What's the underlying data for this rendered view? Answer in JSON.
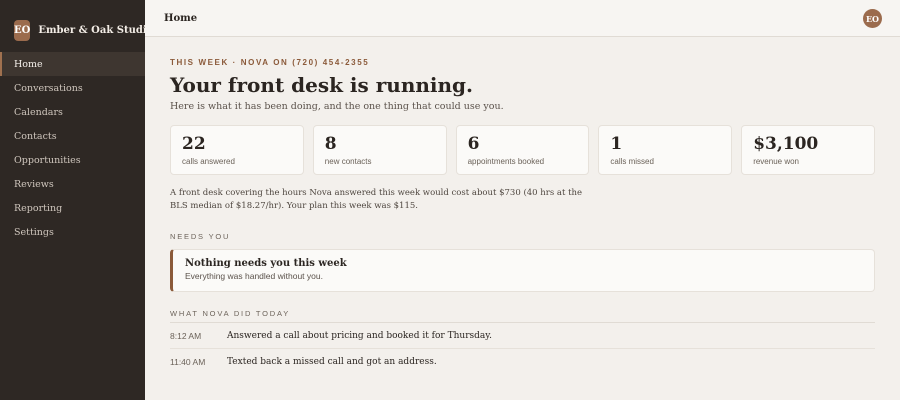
{
  "brand": {
    "badge": "EO",
    "name": "Ember & Oak Studio"
  },
  "sidebar": {
    "items": [
      {
        "label": "Home"
      },
      {
        "label": "Conversations"
      },
      {
        "label": "Calendars"
      },
      {
        "label": "Contacts"
      },
      {
        "label": "Opportunities"
      },
      {
        "label": "Reviews"
      },
      {
        "label": "Reporting"
      },
      {
        "label": "Settings"
      }
    ]
  },
  "header": {
    "title": "Home",
    "avatar": "EO"
  },
  "main": {
    "eyebrow": "THIS WEEK · NOVA ON (720) 454-2355",
    "headline": "Your front desk is running.",
    "subline": "Here is what it has been doing, and the one thing that could use you.",
    "stats": [
      {
        "value": "22",
        "label": "calls answered"
      },
      {
        "value": "8",
        "label": "new contacts"
      },
      {
        "value": "6",
        "label": "appointments booked"
      },
      {
        "value": "1",
        "label": "calls missed"
      },
      {
        "value": "$3,100",
        "label": "revenue won"
      }
    ],
    "cost_note": "A front desk covering the hours Nova answered this week would cost about $730 (40 hrs at the BLS median of $18.27/hr). Your plan this week was $115.",
    "needs": {
      "label": "NEEDS YOU",
      "title": "Nothing needs you this week",
      "subtitle": "Everything was handled without you."
    },
    "activity": {
      "label": "WHAT NOVA DID TODAY",
      "rows": [
        {
          "time": "8:12 AM",
          "text": "Answered a call about pricing and booked it for Thursday."
        },
        {
          "time": "11:40 AM",
          "text": "Texted back a missed call and got an address."
        }
      ]
    }
  },
  "colors": {
    "accent": "#9b6b4d",
    "sidebar_bg": "#2e2824",
    "page_bg": "#f3f0ec"
  }
}
